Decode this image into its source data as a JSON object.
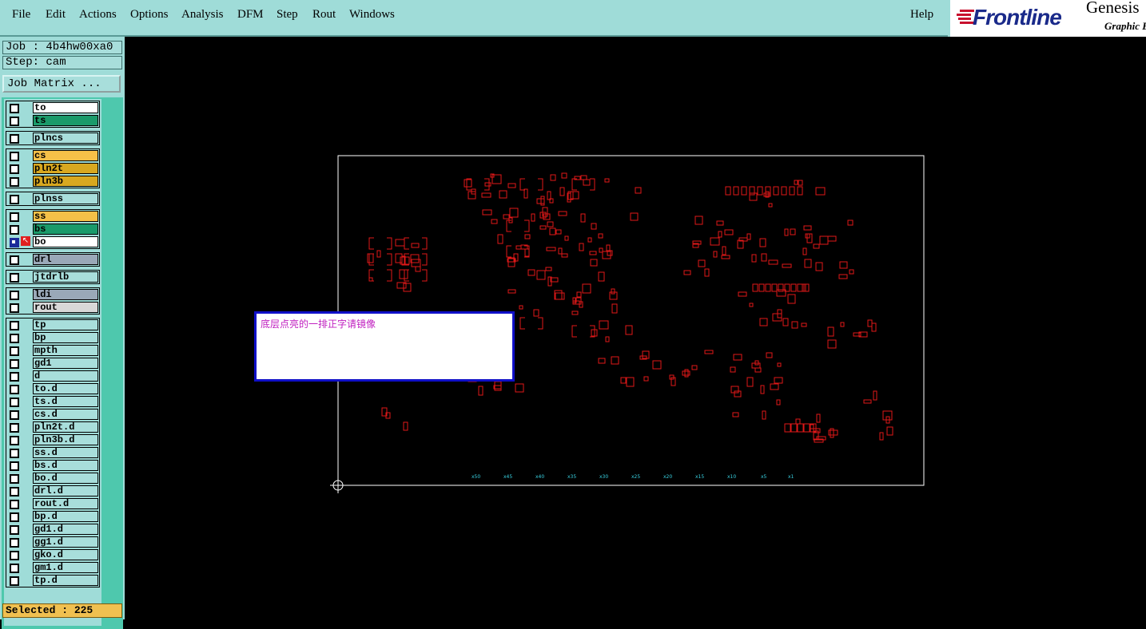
{
  "menubar": {
    "items": [
      "File",
      "Edit",
      "Actions",
      "Options",
      "Analysis",
      "DFM",
      "Step",
      "Rout",
      "Windows"
    ],
    "help": "Help"
  },
  "brand": {
    "logo": "Frontline",
    "product": "Genesis",
    "subtitle": "Graphic E"
  },
  "job": {
    "job_label": "Job : 4b4hw00xa0",
    "step_label": "Step: cam",
    "matrix_button": "Job Matrix ..."
  },
  "layers": [
    {
      "name": "to",
      "color": "#ffffff"
    },
    {
      "name": "ts",
      "color": "#1a9a6a"
    },
    {
      "name": "plncs",
      "color": "#a8dedb"
    },
    {
      "name": "cs",
      "color": "#f5c048"
    },
    {
      "name": "pln2t",
      "color": "#d8a820"
    },
    {
      "name": "pln3b",
      "color": "#d8a820"
    },
    {
      "name": "plnss",
      "color": "#a8dedb"
    },
    {
      "name": "ss",
      "color": "#f5c048"
    },
    {
      "name": "bs",
      "color": "#1a9a6a"
    },
    {
      "name": "bo",
      "color": "#ffffff"
    },
    {
      "name": "drl",
      "color": "#9aa8b8"
    },
    {
      "name": "jtdrlb",
      "color": "#a8dedb"
    },
    {
      "name": "ldi",
      "color": "#9aa8b8"
    },
    {
      "name": "rout",
      "color": "#d8d8d8"
    },
    {
      "name": "tp",
      "color": "#a8dedb"
    },
    {
      "name": "bp",
      "color": "#a8dedb"
    },
    {
      "name": "mpth",
      "color": "#a8dedb"
    },
    {
      "name": "gd1",
      "color": "#a8dedb"
    },
    {
      "name": "d",
      "color": "#a8dedb"
    },
    {
      "name": "to.d",
      "color": "#a8dedb"
    },
    {
      "name": "ts.d",
      "color": "#a8dedb"
    },
    {
      "name": "cs.d",
      "color": "#a8dedb"
    },
    {
      "name": "pln2t.d",
      "color": "#a8dedb"
    },
    {
      "name": "pln3b.d",
      "color": "#a8dedb"
    },
    {
      "name": "ss.d",
      "color": "#a8dedb"
    },
    {
      "name": "bs.d",
      "color": "#a8dedb"
    },
    {
      "name": "bo.d",
      "color": "#a8dedb"
    },
    {
      "name": "drl.d",
      "color": "#a8dedb"
    },
    {
      "name": "rout.d",
      "color": "#a8dedb"
    },
    {
      "name": "bp.d",
      "color": "#a8dedb"
    },
    {
      "name": "gd1.d",
      "color": "#a8dedb"
    },
    {
      "name": "gg1.d",
      "color": "#a8dedb"
    },
    {
      "name": "gko.d",
      "color": "#a8dedb"
    },
    {
      "name": "gm1.d",
      "color": "#a8dedb"
    },
    {
      "name": "tp.d",
      "color": "#a8dedb"
    }
  ],
  "status": {
    "selected": "Selected : 225"
  },
  "note": {
    "text": "底层点亮的一排正字请镜像"
  },
  "colors": {
    "pcb": "#e01818",
    "outline": "#ffffff",
    "marks": "#38d0e0"
  },
  "board_marks": [
    "x50",
    "x45",
    "x40",
    "x35",
    "x30",
    "x25",
    "x20",
    "x15",
    "x10",
    "x5",
    "x1"
  ]
}
